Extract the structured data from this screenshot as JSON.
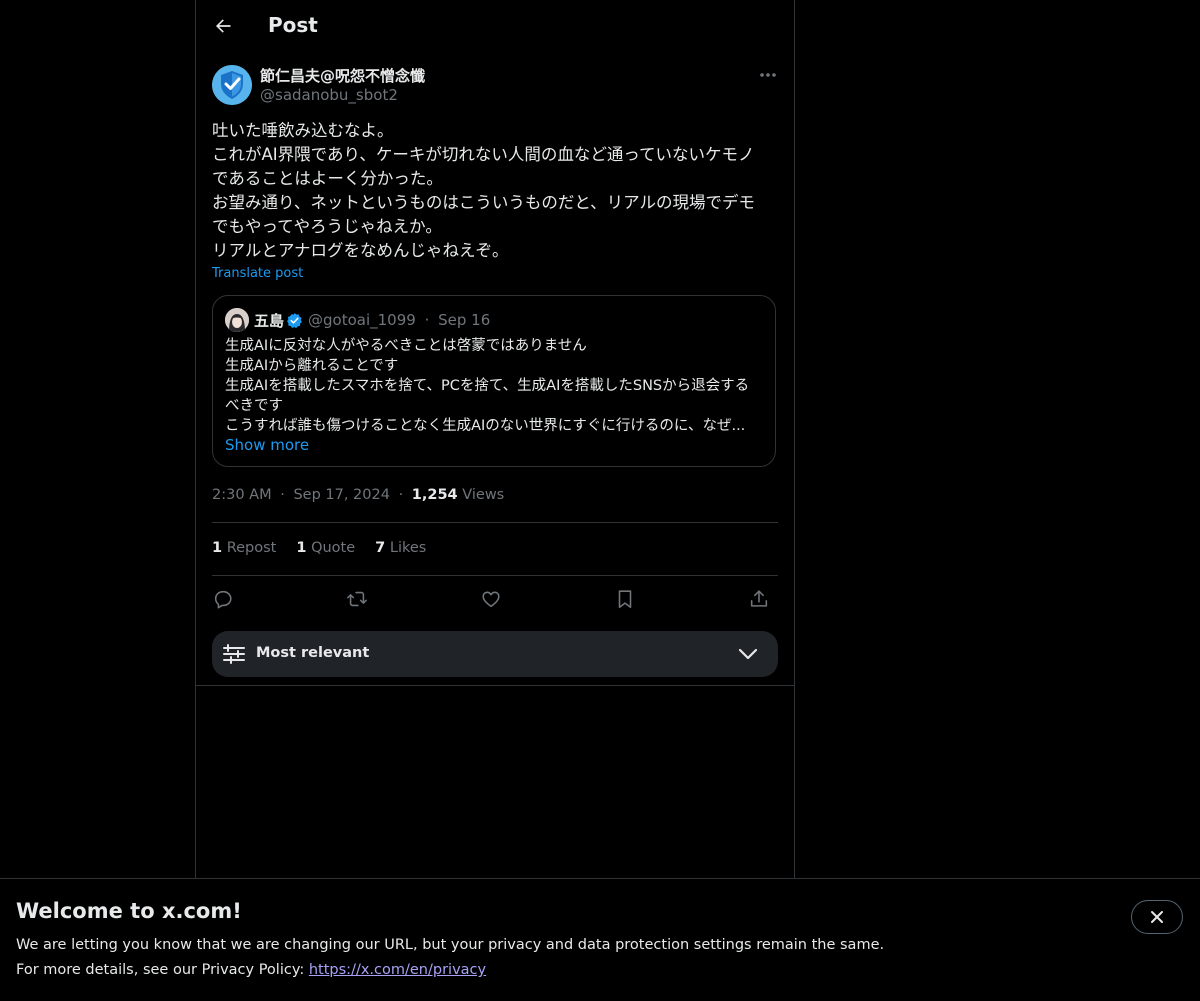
{
  "header": {
    "title": "Post"
  },
  "post": {
    "author_name": "節仁昌夫@呪怨不憎念懺",
    "author_handle": "@sadanobu_sbot2",
    "text_lines": [
      "吐いた唾飲み込むなよ。",
      "これがAI界隈であり、ケーキが切れない人間の血など通っていないケモノ",
      "であることはよーく分かった。",
      "お望み通り、ネットというものはこういうものだと、リアルの現場でデモ",
      "でもやってやろうじゃねえか。",
      "リアルとアナログをなめんじゃねえぞ。"
    ],
    "translate_label": "Translate post"
  },
  "quote": {
    "name": "五島",
    "handle": "@gotoai_1099",
    "separator": "·",
    "date": "Sep 16",
    "text_lines": [
      "生成AIに反対な人がやるべきことは啓蒙ではありません",
      "生成AIから離れることです",
      "生成AIを搭載したスマホを捨て、PCを捨て、生成AIを搭載したSNSから退会する",
      "べきです",
      "こうすれば誰も傷つけることなく生成AIのない世界にすぐに行けるのに、なぜ..."
    ],
    "show_more": "Show more"
  },
  "meta": {
    "time": "2:30 AM",
    "sep": "·",
    "date": "Sep 17, 2024",
    "views_count": "1,254",
    "views_label": "Views"
  },
  "stats": {
    "reposts_count": "1",
    "reposts_label": "Repost",
    "quotes_count": "1",
    "quotes_label": "Quote",
    "likes_count": "7",
    "likes_label": "Likes"
  },
  "actions": [
    "reply-icon",
    "repost-icon",
    "like-icon",
    "bookmark-icon",
    "share-icon"
  ],
  "sort": {
    "label": "Most relevant"
  },
  "banner": {
    "title": "Welcome to x.com!",
    "line1": "We are letting you know that we are changing our URL, but your privacy and data protection settings remain the same.",
    "line2_prefix": "For more details, see our Privacy Policy: ",
    "link": "https://x.com/en/privacy"
  },
  "colors": {
    "accent": "#1d9bf0",
    "muted": "#71767b",
    "link_purple": "#a7a2f5",
    "border": "#2f3336"
  }
}
